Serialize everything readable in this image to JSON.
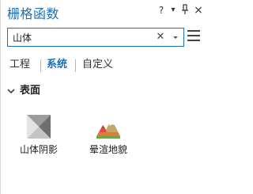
{
  "panel": {
    "title": "栅格函数",
    "help_label": "?",
    "menu_label": "▾",
    "pin_label": "⊥",
    "close_label": "×"
  },
  "search": {
    "value": "山体",
    "placeholder": "",
    "clear_icon": "close-icon",
    "dropdown_icon": "chevron-down-icon"
  },
  "tabs": [
    {
      "label": "工程"
    },
    {
      "label": "系统",
      "active": true
    },
    {
      "label": "自定义"
    }
  ],
  "section": {
    "label": "表面",
    "expanded": true
  },
  "tools": [
    {
      "label": "山体阴影",
      "icon": "hillshade-icon"
    },
    {
      "label": "晕渲地貌",
      "icon": "shaded-relief-icon"
    }
  ],
  "colors": {
    "accent": "#1a6fb5"
  }
}
